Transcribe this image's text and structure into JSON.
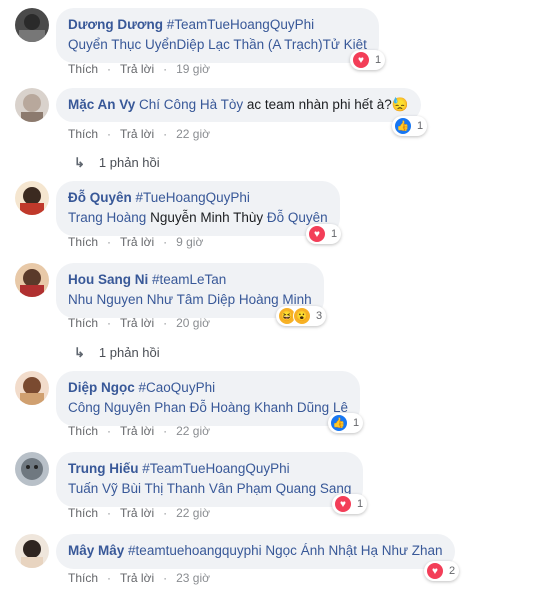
{
  "actions": {
    "like": "Thích",
    "reply": "Trả lời"
  },
  "comments": [
    {
      "author": "Dương Dương",
      "tag": "#TeamTueHoangQuyPhi",
      "text": "Quyển Thục UyểnDiệp Lạc Thần (A Trạch)Tử Kiệt",
      "reaction_count": "1",
      "time": "19 giờ"
    },
    {
      "author": "Mặc An Vy",
      "mention": "Chí Công Hà Tòy",
      "text": "ac team nhàn phi hết à?😓",
      "reaction_count": "1",
      "time": "22 giờ",
      "replies": "1 phản hồi"
    },
    {
      "author": "Đỗ Quyên",
      "tag": "#TueHoangQuyPhi",
      "text_a": "Trang Hoàng",
      "text_b": "Nguyễn Minh Thùy",
      "text_c": "Đỗ Quyên",
      "reaction_count": "1",
      "time": "9 giờ"
    },
    {
      "author": "Hou Sang Ni",
      "tag": "#teamLeTan",
      "text": "Nhu Nguyen Như Tâm Diệp Hoàng Minh",
      "reaction_count": "3",
      "time": "20 giờ",
      "replies": "1 phản hồi"
    },
    {
      "author": "Diệp Ngọc",
      "tag": "#CaoQuyPhi",
      "text": "Công Nguyên Phan Đỗ Hoàng Khanh Dũng Lê",
      "reaction_count": "1",
      "time": "22 giờ"
    },
    {
      "author": "Trung Hiếu",
      "tag": "#TeamTueHoangQuyPhi",
      "text": "Tuấn Vỹ Bùi Thị Thanh Vân Phạm Quang Sang",
      "reaction_count": "1",
      "time": "22 giờ"
    },
    {
      "author": "Mây Mây",
      "tag": "#teamtuehoangquyphi",
      "text": "Ngọc Ánh Nhật Hạ Như Zhan",
      "reaction_count": "2",
      "time": "23 giờ"
    }
  ]
}
